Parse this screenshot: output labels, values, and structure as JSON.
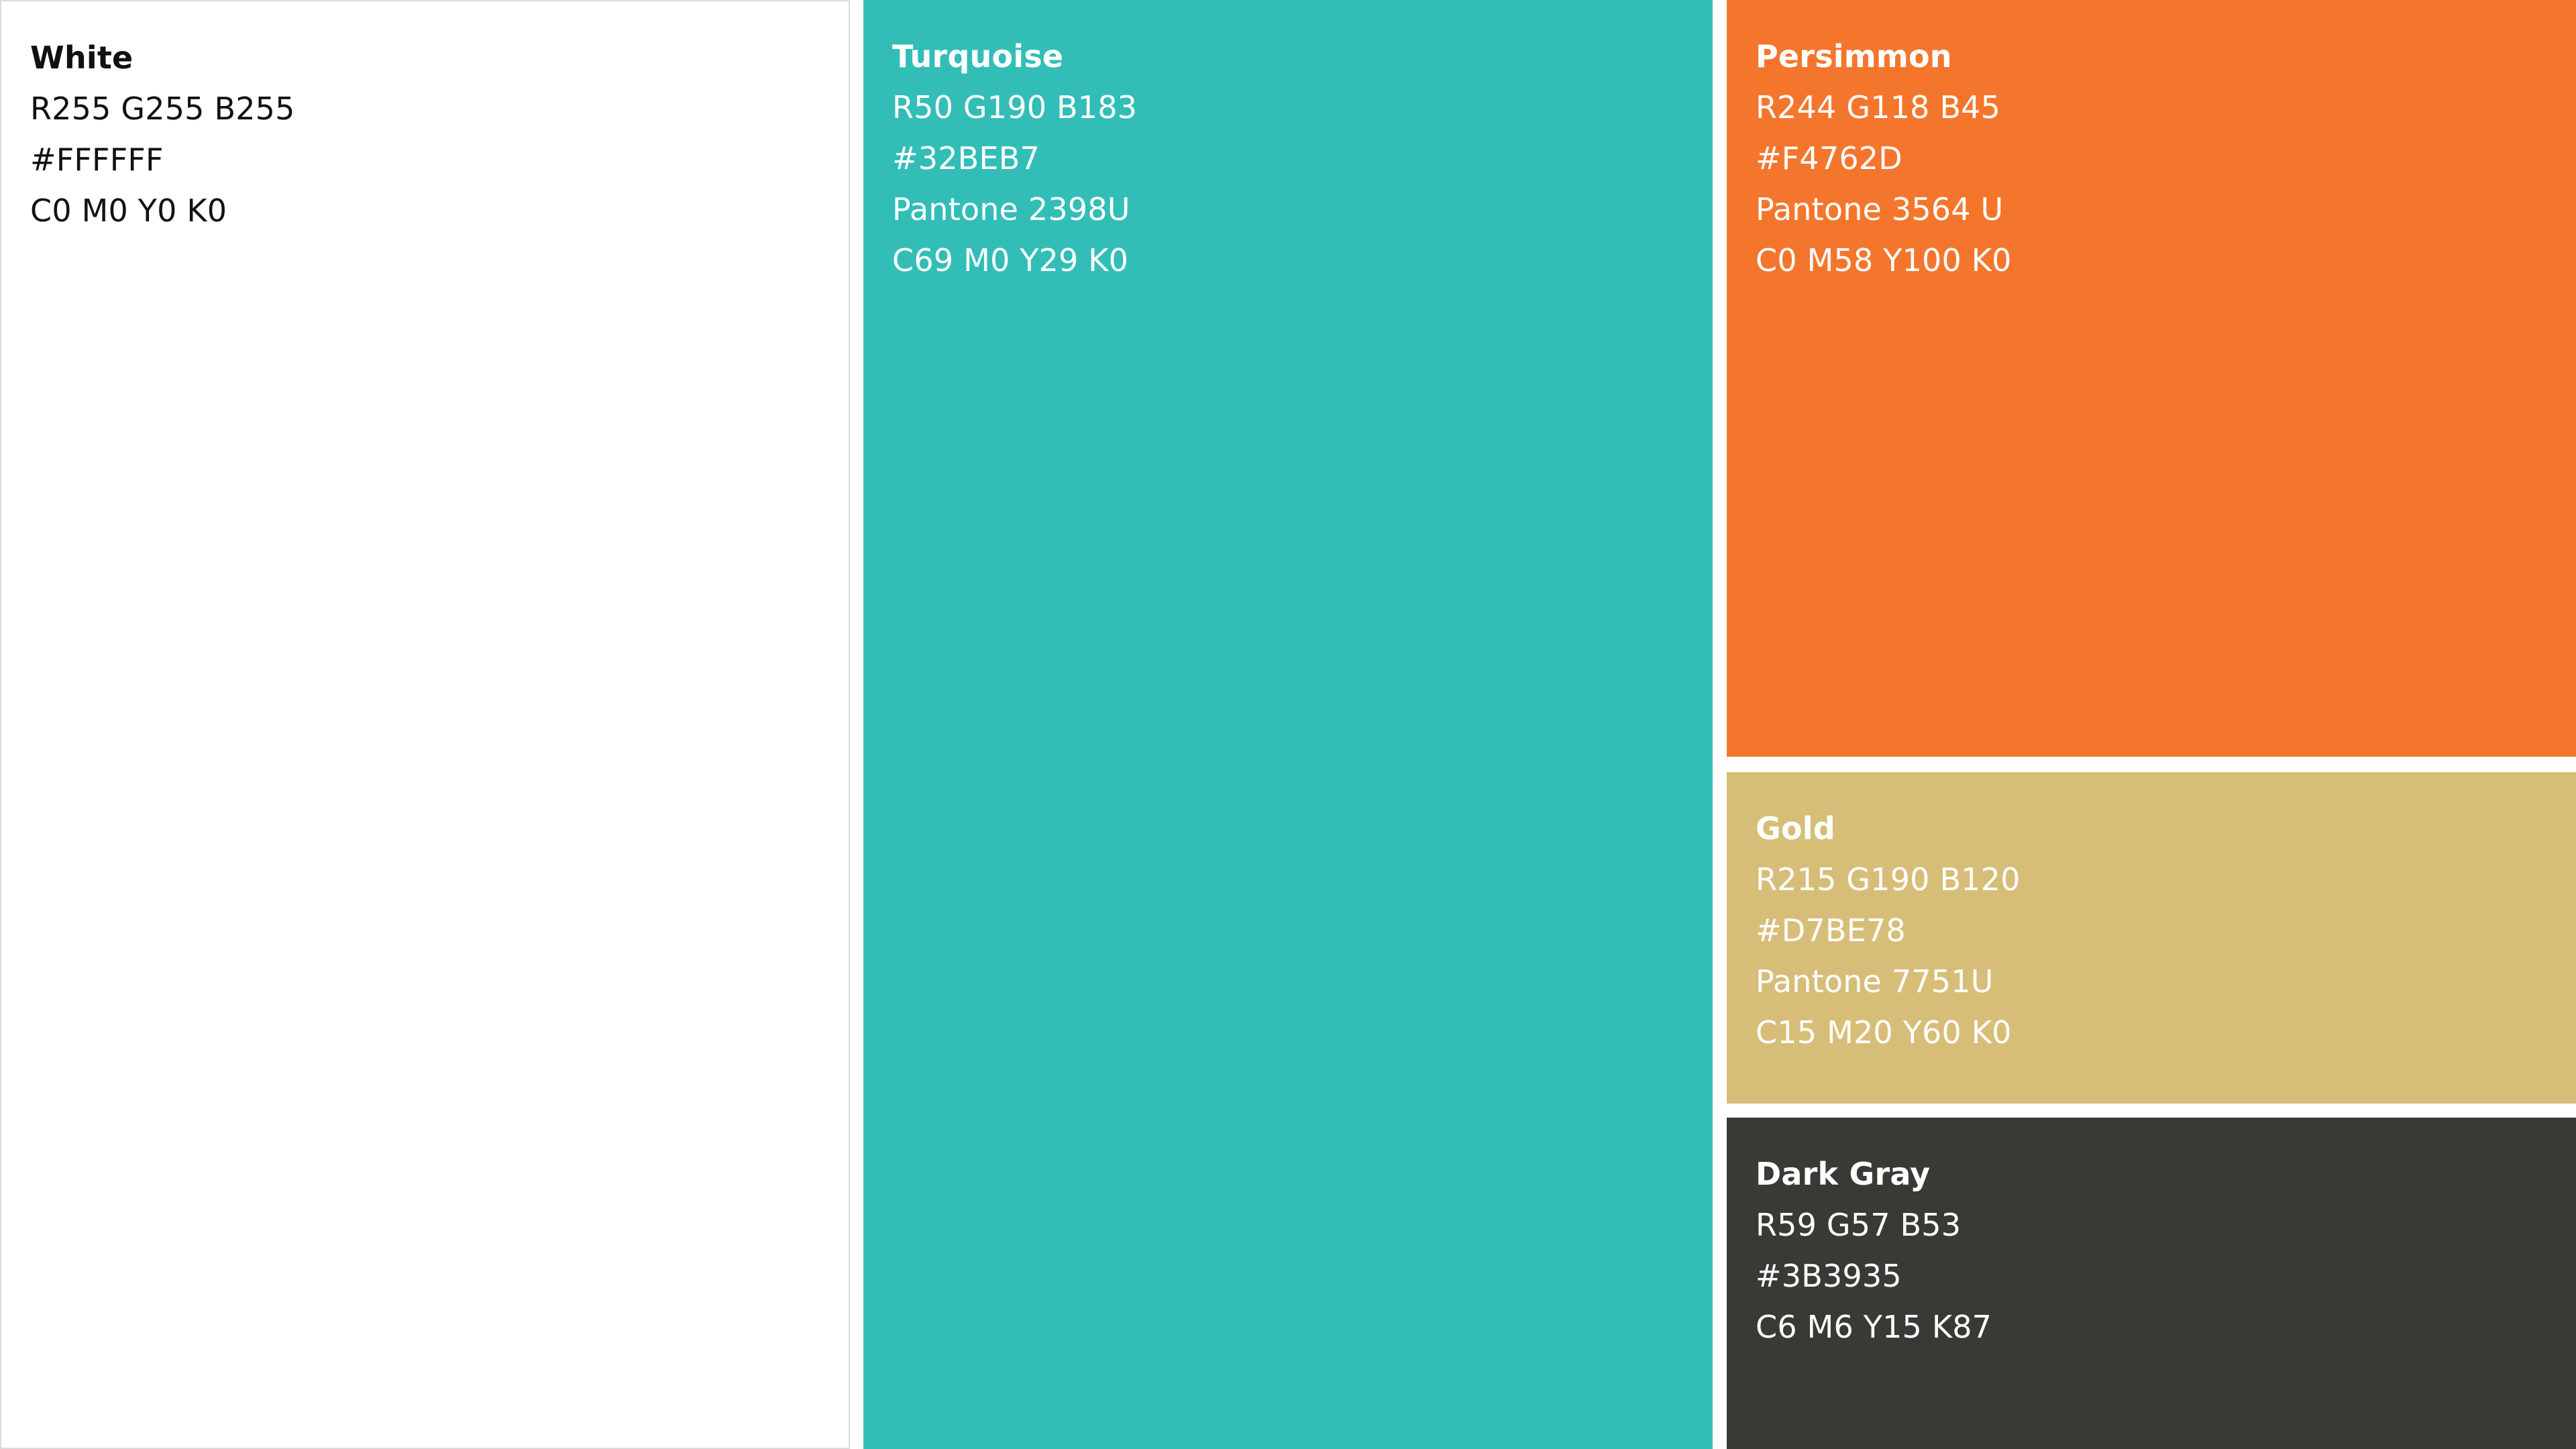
{
  "swatches": [
    {
      "name": "White",
      "rgb": "R255 G255 B255",
      "hex": "#FFFFFF",
      "cmyk": "C0 M0 Y0 K0",
      "color": "#FFFFFF",
      "text_color": "#111111"
    },
    {
      "name": "Turquoise",
      "rgb": "R50 G190 B183",
      "hex": "#32BEB7",
      "pantone": "Pantone 2398U",
      "cmyk": "C69 M0 Y29 K0",
      "color": "#32BEB7",
      "text_color": "#FFFFFF"
    },
    {
      "name": "Persimmon",
      "rgb": "R244 G118 B45",
      "hex": "#F4762D",
      "pantone": "Pantone 3564 U",
      "cmyk": "C0 M58 Y100 K0",
      "color": "#F4762D",
      "text_color": "#FFFFFF"
    },
    {
      "name": "Gold",
      "rgb": "R215 G190 B120",
      "hex": "#D7BE78",
      "pantone": "Pantone 7751U",
      "cmyk": "C15 M20 Y60 K0",
      "color": "#D7BE78",
      "text_color": "#FFFFFF"
    },
    {
      "name": "Dark Gray",
      "rgb": "R59 G57 B53",
      "hex": "#3B3935",
      "cmyk": "C6 M6 Y15 K87",
      "color": "#3B3935",
      "text_color": "#FFFFFF"
    }
  ]
}
